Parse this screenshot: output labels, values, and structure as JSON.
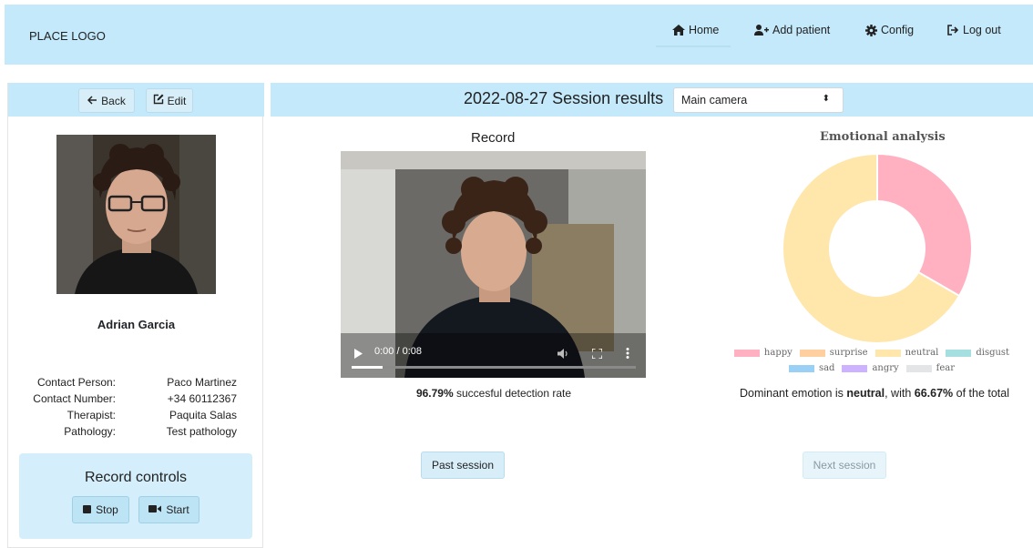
{
  "navbar": {
    "logo": "PLACE LOGO",
    "items": [
      {
        "label": "Home",
        "icon": "home-icon"
      },
      {
        "label": "Add patient",
        "icon": "add-user-icon"
      },
      {
        "label": "Config",
        "icon": "gear-icon"
      },
      {
        "label": "Log out",
        "icon": "logout-icon"
      }
    ]
  },
  "patient": {
    "back_label": "Back",
    "edit_label": "Edit",
    "name": "Adrian Garcia",
    "info": [
      {
        "key": "Contact Person:",
        "value": "Paco Martinez"
      },
      {
        "key": "Contact Number:",
        "value": "+34 60112367"
      },
      {
        "key": "Therapist:",
        "value": "Paquita Salas"
      },
      {
        "key": "Pathology:",
        "value": "Test pathology"
      }
    ]
  },
  "record_controls": {
    "title": "Record controls",
    "stop_label": "Stop",
    "start_label": "Start"
  },
  "session": {
    "title": "2022-08-27 Session results",
    "camera_selected": "Main camera",
    "camera_arrow": "⬍",
    "record_label": "Record",
    "video_time": "0:00 / 0:08",
    "video_progress": 0.11,
    "detection_rate": "96.79%",
    "detection_suffix": " succesful detection rate",
    "past_label": "Past session",
    "next_label": "Next session"
  },
  "emotion": {
    "title": "Emotional analysis",
    "dominant_prefix": "Dominant emotion is ",
    "dominant_emotion": "neutral",
    "dominant_mid": ", with ",
    "dominant_pct": "66.67%",
    "dominant_suffix": " of the total"
  },
  "chart_data": {
    "type": "pie",
    "title": "Emotional analysis",
    "legend": "bottom",
    "categories": [
      "happy",
      "surprise",
      "neutral",
      "disgust",
      "sad",
      "angry",
      "fear"
    ],
    "values": [
      33.33,
      0,
      66.67,
      0,
      0,
      0,
      0
    ],
    "colors": [
      "#ffb1c1",
      "#ffcf9f",
      "#ffe6aa",
      "#a5dfdf",
      "#9ad0f5",
      "#ccb2ff",
      "#e4e5e7"
    ]
  }
}
